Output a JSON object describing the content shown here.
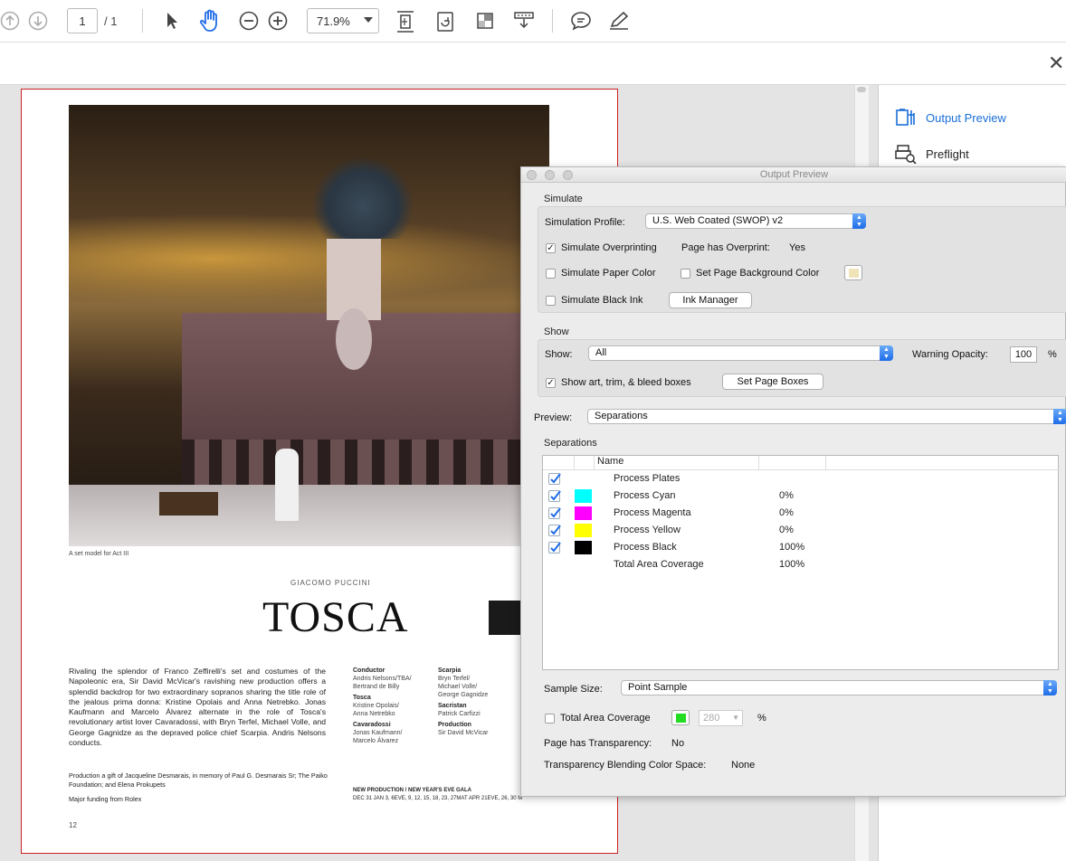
{
  "toolbar": {
    "page_current": "1",
    "page_total": "/ 1",
    "zoom": "71.9%",
    "icons": [
      "arrow-up-icon",
      "arrow-down-icon",
      "select-arrow-icon",
      "hand-icon",
      "zoom-out-icon",
      "zoom-in-icon",
      "fit-page-icon",
      "rotate-icon",
      "crop-icon",
      "stamp-icon",
      "comment-icon",
      "pen-icon"
    ]
  },
  "right_panel": {
    "items": [
      {
        "label": "Output Preview",
        "color": "#1a6ed8"
      },
      {
        "label": "Preflight",
        "color": "#222222"
      }
    ]
  },
  "document": {
    "caption": "A set model for Act III",
    "composer": "GIACOMO PUCCINI",
    "title": "TOSCA",
    "body": "Rivaling the splendor of Franco Zeffirelli's set and costumes of the Napoleonic era, Sir David McVicar's ravishing new production offers a splendid backdrop for two extraordinary sopranos sharing the title role of the jealous prima donna: Kristine Opolais and Anna Netrebko. Jonas Kaufmann and Marcelo Álvarez alternate in the role of Tosca's revolutionary artist lover Cavaradossi, with Bryn Terfel, Michael Volle, and George Gagnidze as the depraved police chief Scarpia. Andris Nelsons conducts.",
    "credits_left": [
      {
        "role": "Conductor",
        "names": "Andris Nelsons/TBA/\nBertrand de Billy"
      },
      {
        "role": "Tosca",
        "names": "Kristine Opolais/\nAnna Netrebko"
      },
      {
        "role": "Cavaradossi",
        "names": "Jonas Kaufmann/\nMarcelo Álvarez"
      }
    ],
    "credits_right": [
      {
        "role": "Scarpia",
        "names": "Bryn Terfel/\nMichael Volle/\nGeorge Gagnidze"
      },
      {
        "role": "Sacristan",
        "names": "Patrick Carfizzi"
      },
      {
        "role": "Production",
        "names": "Sir David McVicar"
      }
    ],
    "footnote1": "Production a gift of Jacqueline Desmarais, in memory of Paul G. Desmarais Sr; The Paiko Foundation; and Elena Prokupets",
    "footnote2": "Major funding from Rolex",
    "gala_title": "NEW PRODUCTION / NEW YEAR'S EVE GALA",
    "gala_dates": "DEC 31 JAN 3, 6EVE, 9, 12, 15, 18, 23, 27MAT APR 21EVE, 26, 30 M",
    "page_number": "12"
  },
  "dialog": {
    "title": "Output Preview",
    "simulate_section": "Simulate",
    "simulation_profile_label": "Simulation Profile:",
    "simulation_profile_value": "U.S. Web Coated (SWOP) v2",
    "simulate_overprinting_label": "Simulate Overprinting",
    "simulate_overprinting_checked": true,
    "overprint_label": "Page has Overprint:",
    "overprint_value": "Yes",
    "paper_color_label": "Simulate Paper Color",
    "bg_color_label": "Set Page Background Color",
    "bg_swatch_color": "#efe4b8",
    "black_ink_label": "Simulate Black Ink",
    "ink_manager_label": "Ink Manager",
    "show_section": "Show",
    "show_label": "Show:",
    "show_value": "All",
    "warning_opacity_label": "Warning Opacity:",
    "warning_opacity_value": "100",
    "percent_sign": "%",
    "bleed_boxes_label": "Show art, trim, & bleed boxes",
    "set_page_boxes_label": "Set Page Boxes",
    "preview_label": "Preview:",
    "preview_value": "Separations",
    "separations_section": "Separations",
    "sep_header_name": "Name",
    "separations": [
      {
        "name": "Process Plates",
        "pct": "",
        "color": "",
        "check": true
      },
      {
        "name": "Process Cyan",
        "pct": "0%",
        "color": "#00ffff",
        "check": true
      },
      {
        "name": "Process Magenta",
        "pct": "0%",
        "color": "#ff00ff",
        "check": true
      },
      {
        "name": "Process Yellow",
        "pct": "0%",
        "color": "#ffff00",
        "check": true
      },
      {
        "name": "Process Black",
        "pct": "100%",
        "color": "#000000",
        "check": true
      },
      {
        "name": "Total Area Coverage",
        "pct": "100%",
        "color": "",
        "check": false
      }
    ],
    "sample_size_label": "Sample Size:",
    "sample_size_value": "Point Sample",
    "total_area_label": "Total Area Coverage",
    "total_area_swatch": "#22dd22",
    "total_area_value": "280",
    "transparency_label": "Page has Transparency:",
    "transparency_value": "No",
    "blend_space_label": "Transparency Blending Color Space:",
    "blend_space_value": "None"
  }
}
